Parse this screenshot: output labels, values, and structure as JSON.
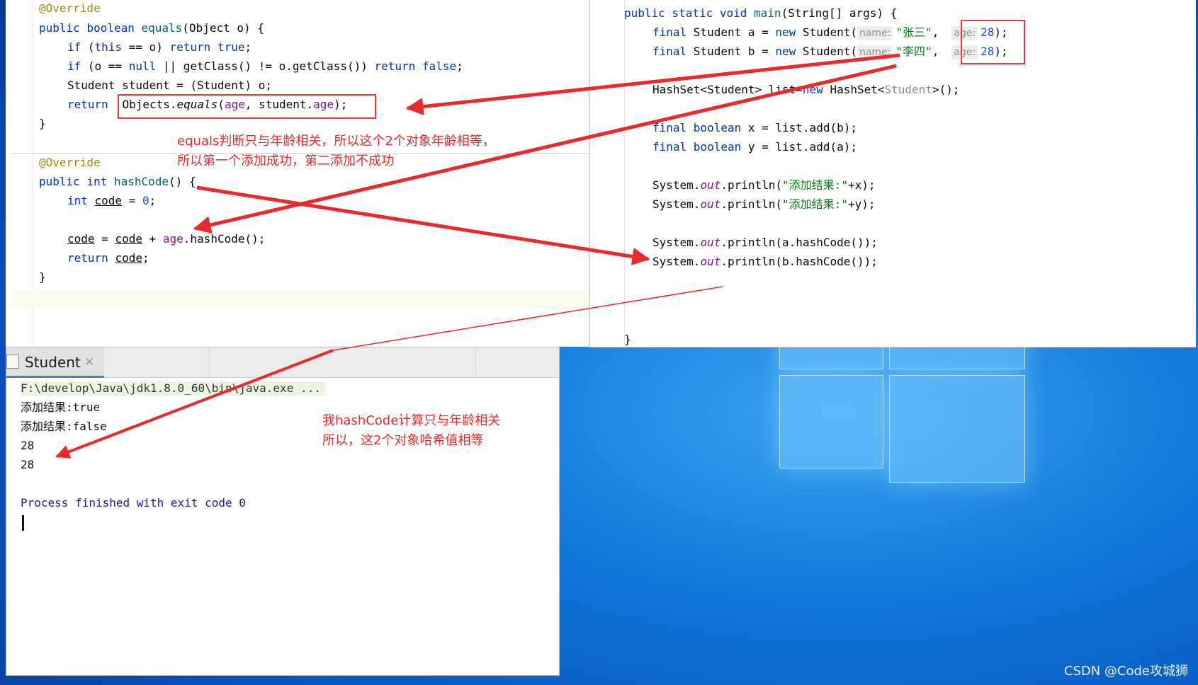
{
  "left_editor": {
    "equals_method": {
      "annotation": "@Override",
      "signature": [
        "public ",
        "boolean ",
        "equals",
        "(Object o) {"
      ],
      "line1": [
        "if ",
        "(",
        "this",
        " == o) ",
        "return ",
        "true",
        ";"
      ],
      "line2": [
        "if ",
        "(o == ",
        "null",
        " || getClass() != o.getClass()) ",
        "return ",
        "false",
        ";"
      ],
      "line3": "Student student = (Student) o;",
      "line4_return": "return ",
      "line4_expr": [
        "Objects.",
        "equals",
        "(",
        "age",
        ", student.",
        "age",
        ");"
      ],
      "close": "}"
    },
    "hashcode_method": {
      "annotation": "@Override",
      "signature": [
        "public ",
        "int ",
        "hashCode",
        "() {"
      ],
      "line1": [
        "int ",
        "code",
        " = ",
        "0",
        ";"
      ],
      "line2": [
        "code",
        " = ",
        "code",
        " + ",
        "age",
        ".hashCode();"
      ],
      "line3": [
        "return ",
        "code",
        ";"
      ],
      "close": "}"
    },
    "note_equals": "equals判断只与年龄相关，所以这个2个对象年龄相等，\n所以第一个添加成功，第二添加不成功"
  },
  "right_editor": {
    "main_sig": [
      "public static void ",
      "main",
      "(String[] args) {"
    ],
    "line_a": [
      "final ",
      "Student a = ",
      "new ",
      "Student(",
      "name:",
      "\"张三\"",
      ",",
      "age:",
      "28",
      ");"
    ],
    "line_b": [
      "final ",
      "Student b = ",
      "new ",
      "Student(",
      "name:",
      "\"李四\"",
      ",",
      "age:",
      "28",
      ");"
    ],
    "line_set": [
      "HashSet<Student> list=",
      "new ",
      "HashSet<",
      "Student",
      ">();"
    ],
    "line_x": [
      "final boolean ",
      "x = list.add(b);"
    ],
    "line_y": [
      "final boolean ",
      "y = list.add(a);"
    ],
    "line_px": [
      "System.",
      "out",
      ".println(",
      "\"添加结果:\"",
      "+x);"
    ],
    "line_py": [
      "System.",
      "out",
      ".println(",
      "\"添加结果:\"",
      "+y);"
    ],
    "line_ha": [
      "System.",
      "out",
      ".println(a.hashCode());"
    ],
    "line_hb": [
      "System.",
      "out",
      ".println(b.hashCode());"
    ],
    "close": "}"
  },
  "run_panel": {
    "tab_label": "Student",
    "close_glyph": "✕",
    "lines": [
      "F:\\develop\\Java\\jdk1.8.0_60\\bin\\java.exe ...",
      "添加结果:true",
      "添加结果:false",
      "28",
      "28",
      "",
      "Process finished with exit code 0"
    ],
    "note_hashcode": "我hashCode计算只与年龄相关\n所以，这2个对象哈希值相等"
  },
  "watermark": "CSDN @Code攻城狮",
  "colors": {
    "annotation_red": "#ea2a2a",
    "keyword": "#0033b3",
    "string": "#067d17",
    "field": "#871094",
    "number": "#1750eb"
  },
  "icons": [
    "console-icon",
    "close-icon",
    "windows-logo-icon"
  ]
}
